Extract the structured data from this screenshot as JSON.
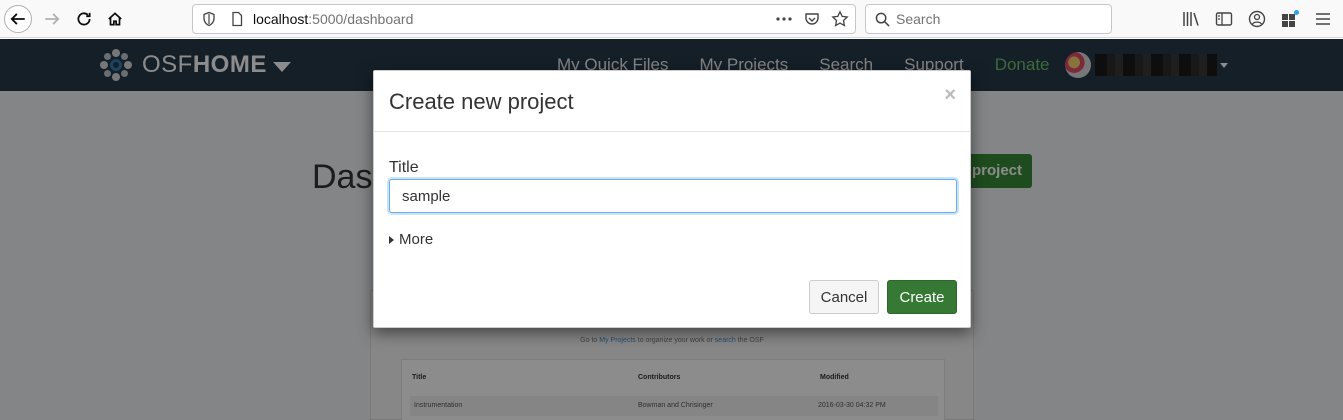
{
  "browser": {
    "url_host": "localhost",
    "url_path": ":5000/dashboard",
    "search_placeholder": "Search"
  },
  "osf_nav": {
    "brand_light": "OSF",
    "brand_bold": "HOME",
    "links": [
      {
        "label": "My Quick Files"
      },
      {
        "label": "My Projects"
      },
      {
        "label": "Search"
      },
      {
        "label": "Support"
      },
      {
        "label": "Donate"
      }
    ]
  },
  "page": {
    "title": "Dashboard",
    "create_project_label": "project",
    "quickstart_hint_prefix": "Go to ",
    "quickstart_hint_link1": "My Projects",
    "quickstart_hint_mid": " to organize your work or ",
    "quickstart_hint_link2": "search",
    "quickstart_hint_suffix": " the OSF",
    "table": {
      "columns": [
        "Title",
        "Contributors",
        "Modified"
      ],
      "rows": [
        {
          "title": "Instrumentation",
          "contributors": "Bowman and Chrisinger",
          "modified": "2016-03-30 04:32 PM"
        }
      ]
    }
  },
  "modal": {
    "title": "Create new project",
    "close_glyph": "×",
    "title_field_label": "Title",
    "title_field_value": "sample",
    "more_label": "More",
    "cancel_label": "Cancel",
    "create_label": "Create"
  },
  "colors": {
    "nav_bg": "#263947",
    "donate": "#6cc26c",
    "create_button": "#357935",
    "input_focus": "#66afe9"
  }
}
